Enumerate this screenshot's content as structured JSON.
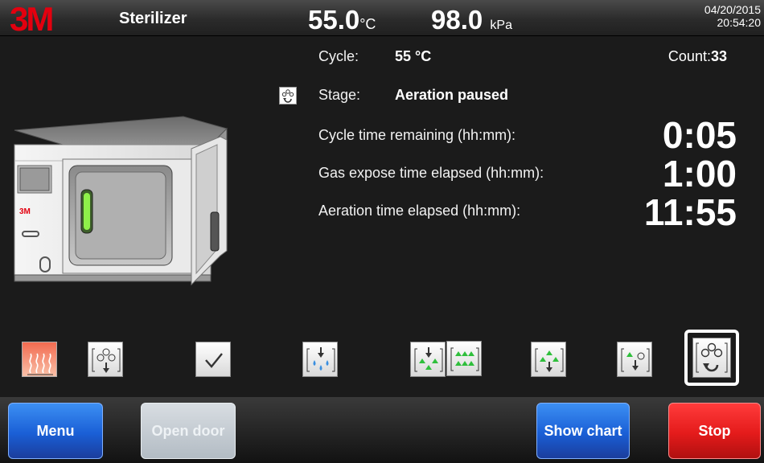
{
  "header": {
    "logo_text": "3M",
    "title": "Sterilizer",
    "temperature": {
      "value": "55.0",
      "unit": "°C"
    },
    "pressure": {
      "value": "98.0",
      "unit": "kPa"
    },
    "date": "04/20/2015",
    "time": "20:54:20"
  },
  "info": {
    "cycle_label": "Cycle:",
    "cycle_value": "55 °C",
    "count_label": "Count:",
    "count_value": "33",
    "stage_label": "Stage:",
    "stage_value": "Aeration paused",
    "rows": [
      {
        "label": "Cycle time remaining (hh:mm):",
        "value": "0:05"
      },
      {
        "label": "Gas expose time elapsed (hh:mm):",
        "value": "1:00"
      },
      {
        "label": "Aeration time elapsed (hh:mm):",
        "value": "11:55"
      }
    ]
  },
  "device": {
    "badge": "3M"
  },
  "stages": [
    {
      "icon": "heating-icon",
      "state": "heat"
    },
    {
      "icon": "vacuum-icon",
      "state": "idle"
    },
    {
      "icon": "checkmark-icon",
      "state": "idle"
    },
    {
      "icon": "humidify-icon",
      "state": "idle"
    },
    {
      "icon": "gas-inject-icon",
      "state": "idle"
    },
    {
      "icon": "gas-expose-icon",
      "state": "idle"
    },
    {
      "icon": "gas-exhaust-icon",
      "state": "idle"
    },
    {
      "icon": "air-wash-icon",
      "state": "idle"
    },
    {
      "icon": "aeration-icon",
      "state": "active"
    }
  ],
  "buttons": {
    "menu": "Menu",
    "open_door": "Open door",
    "show_chart": "Show chart",
    "stop": "Stop"
  },
  "colors": {
    "accent_blue": "#1a5fd6",
    "stop_red": "#e41b1b",
    "indicator_green": "#8ff04a",
    "logo_red": "#e3000f"
  }
}
